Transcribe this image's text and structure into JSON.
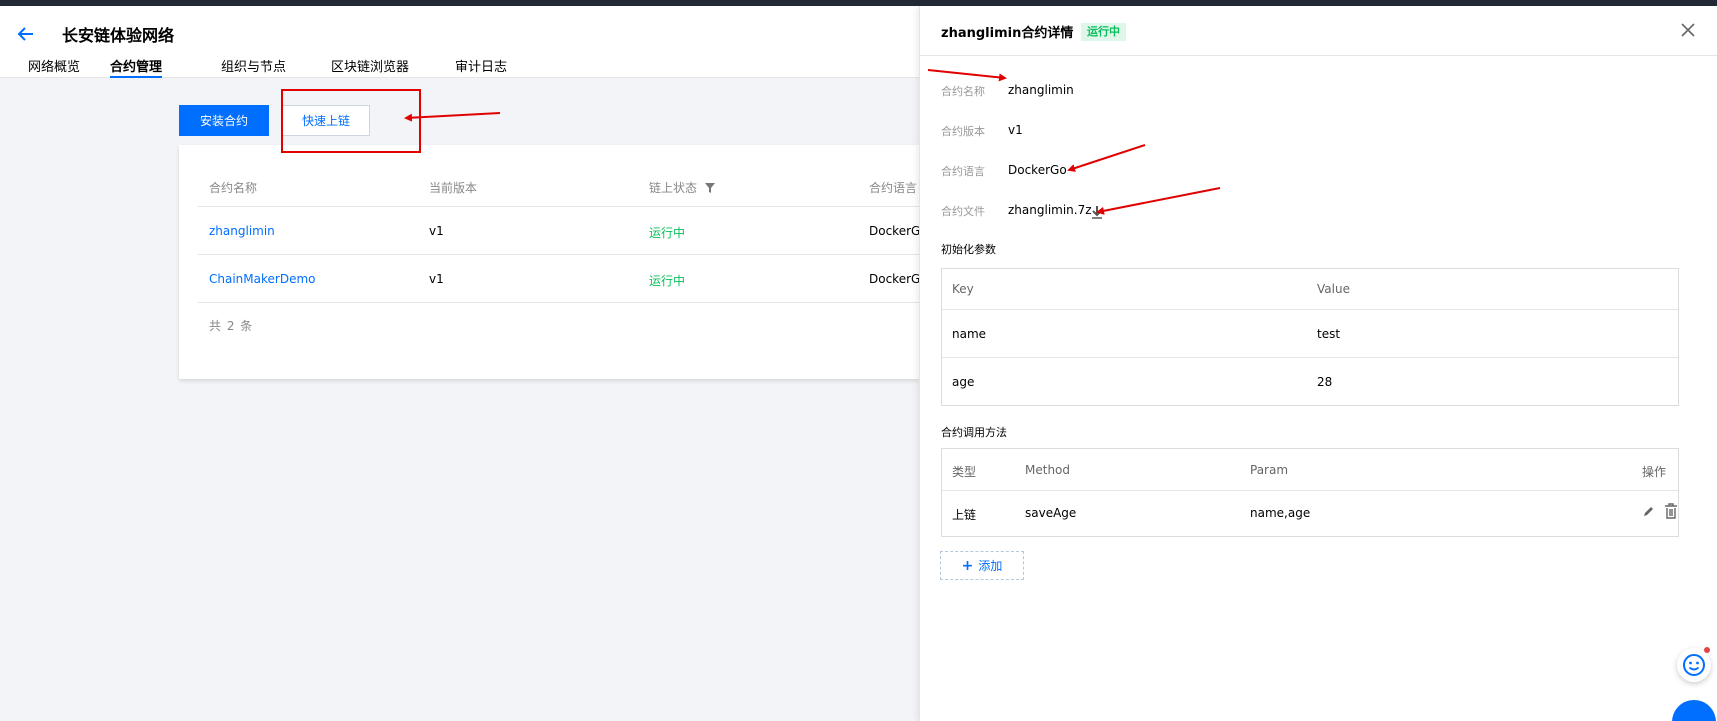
{
  "header": {
    "title": "长安链体验网络",
    "tabs": [
      {
        "label": "网络概览",
        "active": false
      },
      {
        "label": "合约管理",
        "active": true
      },
      {
        "label": "组织与节点",
        "active": false
      },
      {
        "label": "区块链浏览器",
        "active": false
      },
      {
        "label": "审计日志",
        "active": false
      }
    ]
  },
  "toolbar": {
    "install_label": "安装合约",
    "quick_chain_label": "快速上链"
  },
  "contracts_table": {
    "columns": [
      "合约名称",
      "当前版本",
      "链上状态",
      "合约语言"
    ],
    "rows": [
      {
        "name": "zhanglimin",
        "version": "v1",
        "status": "运行中",
        "language": "DockerGo"
      },
      {
        "name": "ChainMakerDemo",
        "version": "v1",
        "status": "运行中",
        "language": "DockerGo"
      }
    ],
    "total_text": "共 2 条"
  },
  "drawer": {
    "title": "zhanglimin合约详情",
    "status_tag": "运行中",
    "fields": [
      {
        "label": "合约名称",
        "value": "zhanglimin"
      },
      {
        "label": "合约版本",
        "value": "v1"
      },
      {
        "label": "合约语言",
        "value": "DockerGo"
      },
      {
        "label": "合约文件",
        "value": "zhanglimin.7z"
      }
    ],
    "init_params": {
      "title": "初始化参数",
      "columns": [
        "Key",
        "Value"
      ],
      "rows": [
        {
          "key": "name",
          "value": "test"
        },
        {
          "key": "age",
          "value": "28"
        }
      ]
    },
    "methods": {
      "title": "合约调用方法",
      "columns": [
        "类型",
        "Method",
        "Param",
        "操作"
      ],
      "rows": [
        {
          "type": "上链",
          "method": "saveAge",
          "param": "name,age"
        }
      ]
    },
    "add_label": "添加"
  },
  "icons": [
    "back-arrow-icon",
    "filter-icon",
    "close-icon",
    "download-icon",
    "edit-icon",
    "trash-icon",
    "plus-icon",
    "smiley-icon"
  ],
  "colors": {
    "primary": "#006eff",
    "success": "#0abf5b",
    "annotation": "#e00000",
    "topbar": "#242a35"
  }
}
